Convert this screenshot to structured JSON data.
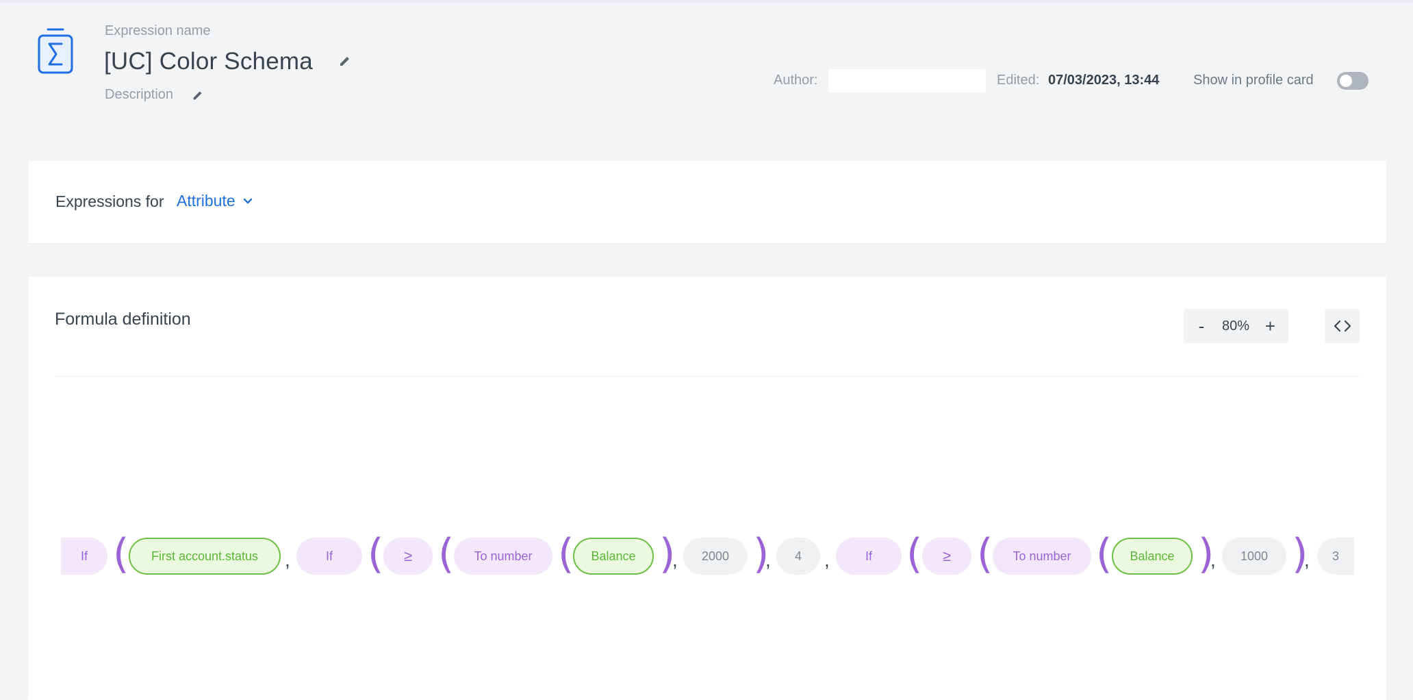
{
  "header": {
    "name_label": "Expression name",
    "title": "[UC] Color Schema",
    "description_label": "Description",
    "author_label": "Author:",
    "author_value": "",
    "edited_label": "Edited:",
    "edited_value": "07/03/2023, 13:44",
    "profile_card_label": "Show in profile card",
    "profile_card_enabled": false
  },
  "expressions_for": {
    "label": "Expressions for",
    "selected": "Attribute"
  },
  "formula": {
    "title": "Formula definition",
    "zoom": "80%",
    "zoom_minus": "-",
    "zoom_plus": "+",
    "tokens": [
      "If",
      "(",
      "First account.status",
      ",",
      "If",
      "(",
      "≥",
      "(",
      "To number",
      "(",
      "Balance",
      ")",
      ",",
      "2000",
      ")",
      ",",
      "4",
      ",",
      "If",
      "(",
      "≥",
      "(",
      "To number",
      "(",
      "Balance",
      ")",
      ",",
      "1000",
      ")",
      ",",
      "3"
    ]
  },
  "colors": {
    "accent": "#1f6fe3",
    "function_bg": "#f3e8fb",
    "function_text": "#9a63d6",
    "attribute_bg": "#ecf9e1",
    "attribute_border": "#6cc144",
    "number_bg": "#f0f1f3"
  }
}
